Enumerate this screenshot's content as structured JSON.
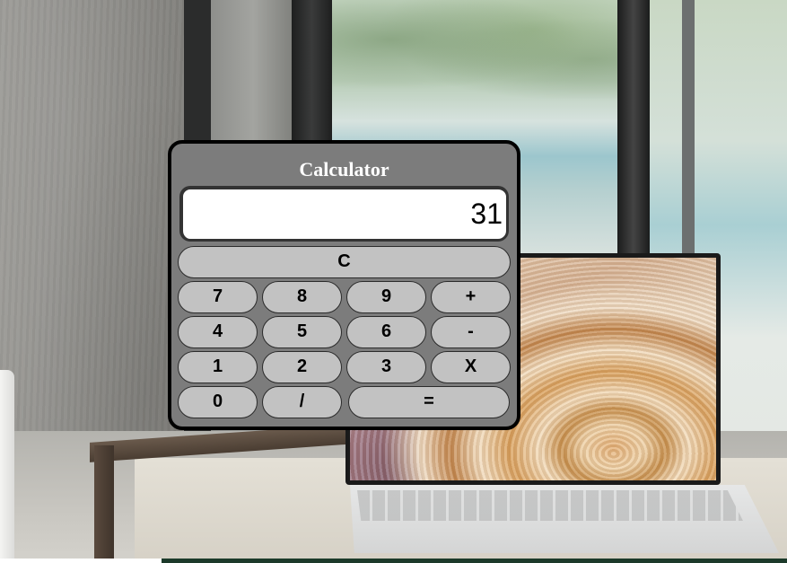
{
  "calculator": {
    "title": "Calculator",
    "display_value": "31",
    "buttons": {
      "clear": "C",
      "row1": [
        "7",
        "8",
        "9",
        "+"
      ],
      "row2": [
        "4",
        "5",
        "6",
        "-"
      ],
      "row3": [
        "1",
        "2",
        "3",
        "X"
      ],
      "row4": [
        "0",
        "/",
        "="
      ]
    }
  },
  "colors": {
    "body": "#7c7c7c",
    "button": "#c2c2c2",
    "display": "#ffffff",
    "title_text": "#ffffff"
  }
}
